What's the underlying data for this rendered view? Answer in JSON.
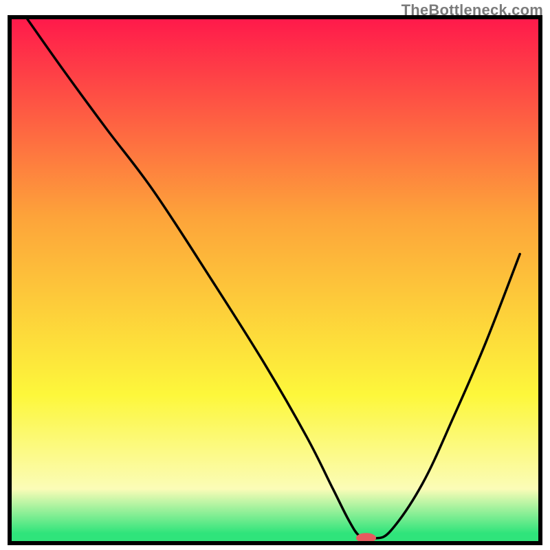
{
  "watermark": {
    "text": "TheBottleneck.com"
  },
  "colors": {
    "red": "#ff1a4b",
    "orange": "#fda43a",
    "yellow": "#fdf73b",
    "paleyellow": "#fbfcb7",
    "green": "#2fe47b",
    "black": "#000000",
    "marker": "#e65a5f"
  },
  "chart_data": {
    "type": "line",
    "title": "",
    "xlabel": "",
    "ylabel": "",
    "xlim": [
      0,
      100
    ],
    "ylim": [
      0,
      100
    ],
    "description": "V-shaped bottleneck curve over a vertical red→orange→yellow→green heat gradient. Curve descends from top-left, has a slight knee around x≈27, reaches ~0 around x≈65–69, then rises toward upper-right. A small pink pill marker sits at the valley bottom on the green band.",
    "grid": false,
    "legend": false,
    "series": [
      {
        "name": "bottleneck-curve",
        "x": [
          3,
          10,
          18,
          27,
          38,
          48,
          56,
          61,
          64,
          66,
          68,
          69,
          72,
          78,
          84,
          90,
          96.5
        ],
        "values": [
          100,
          90,
          79,
          67,
          50,
          34,
          20,
          10,
          4,
          1,
          0.5,
          0.5,
          2,
          11,
          24,
          38,
          55
        ]
      }
    ],
    "marker": {
      "x": 67.3,
      "y": 0.6,
      "rx_pct": 1.9,
      "ry_pct": 0.95
    },
    "gradient_stops": [
      {
        "offset": 0.0,
        "key": "red"
      },
      {
        "offset": 0.38,
        "key": "orange"
      },
      {
        "offset": 0.72,
        "key": "yellow"
      },
      {
        "offset": 0.9,
        "key": "paleyellow"
      },
      {
        "offset": 0.985,
        "key": "green"
      },
      {
        "offset": 1.0,
        "key": "green"
      }
    ]
  },
  "layout": {
    "outer": 800,
    "inner_x": 17,
    "inner_y": 28,
    "inner_w": 766,
    "inner_h": 759,
    "frame_stroke": 6
  }
}
